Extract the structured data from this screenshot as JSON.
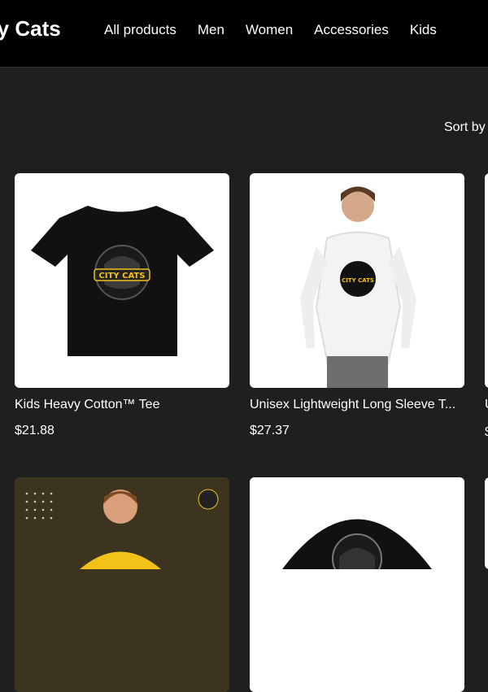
{
  "header": {
    "brand": "ty Cats",
    "nav": [
      "All products",
      "Men",
      "Women",
      "Accessories",
      "Kids"
    ]
  },
  "toolbar": {
    "sort_label": "Sort by"
  },
  "products": [
    {
      "title": "Kids Heavy Cotton™ Tee",
      "price": "$21.88"
    },
    {
      "title": "Unisex Lightweight Long Sleeve T...",
      "price": "$27.37"
    }
  ],
  "partial_edge": {
    "title_char": "U",
    "price_char": "$"
  },
  "logo_text": "CITY CATS",
  "colors": {
    "header_bg": "#000000",
    "page_bg": "#1f1f1f",
    "card_bg": "#ffffff",
    "accent_yellow": "#f2c21b"
  }
}
